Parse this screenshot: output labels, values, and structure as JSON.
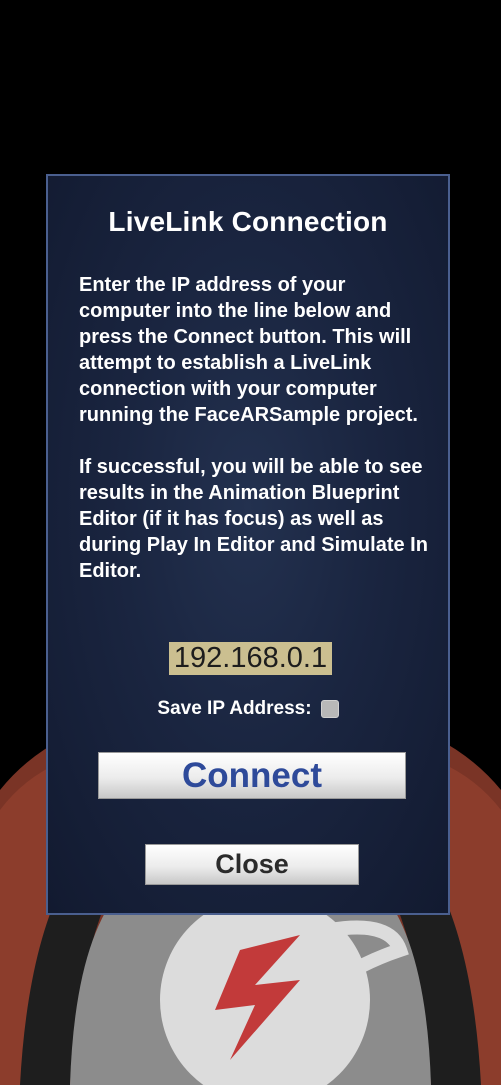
{
  "dialog": {
    "title": "LiveLink Connection",
    "paragraph_1": "Enter the IP address of your computer into the line below and press the Connect button. This will attempt to establish a LiveLink connection with your computer running the FaceARSample project.",
    "paragraph_2": "If successful, you will be able to see results in the Animation Blueprint Editor (if it has focus) as well as during Play In Editor and Simulate In Editor.",
    "ip_value": "192.168.0.1",
    "save_ip_label": "Save IP Address:",
    "save_ip_checked": false,
    "connect_label": "Connect",
    "close_label": "Close"
  },
  "colors": {
    "dialog_background": "#1a2540",
    "dialog_border": "#4a5f8f",
    "ip_field_background": "#cbbf90",
    "connect_text": "#2e4a9a",
    "close_text": "#2b2b2b"
  }
}
